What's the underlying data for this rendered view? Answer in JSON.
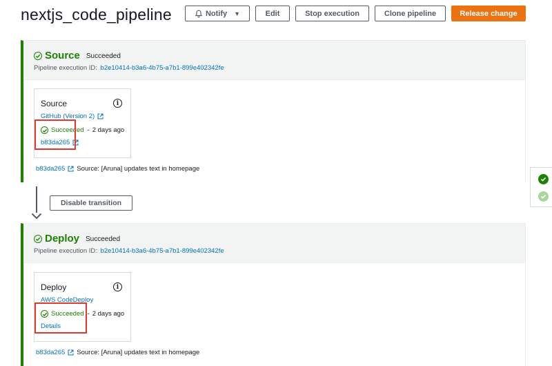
{
  "page": {
    "title": "nextjs_code_pipeline"
  },
  "toolbar": {
    "notify_label": "Notify",
    "edit_label": "Edit",
    "stop_label": "Stop execution",
    "clone_label": "Clone pipeline",
    "release_label": "Release change"
  },
  "colors": {
    "success": "#1d8102",
    "link": "#0073bb",
    "primary": "#ec7211",
    "highlight": "#e0382d"
  },
  "stages": [
    {
      "name": "Source",
      "status": "Succeeded",
      "exec_label": "Pipeline execution ID:",
      "exec_id": "b2e10414-b3a6-4b75-a7b1-899e402342fe",
      "action": {
        "name": "Source",
        "provider": "GitHub (Version 2)",
        "status": "Succeeded",
        "separator": "-",
        "ago": "2 days ago",
        "link": "b83da265"
      },
      "commit": {
        "rev": "b83da265",
        "message": "Source: [Aruna] updates text in homepage"
      }
    },
    {
      "name": "Deploy",
      "status": "Succeeded",
      "exec_label": "Pipeline execution ID:",
      "exec_id": "b2e10414-b3a6-4b75-a7b1-899e402342fe",
      "action": {
        "name": "Deploy",
        "provider": "AWS CodeDeploy",
        "status": "Succeeded",
        "separator": "-",
        "ago": "2 days ago",
        "link": "Details"
      },
      "commit": {
        "rev": "b83da265",
        "message": "Source: [Aruna] updates text in homepage"
      }
    }
  ],
  "transition": {
    "disable_label": "Disable transition"
  },
  "icons": [
    "bell-icon",
    "caret-down-icon",
    "check-circle-icon",
    "info-icon",
    "external-link-icon",
    "arrow-down-icon"
  ]
}
